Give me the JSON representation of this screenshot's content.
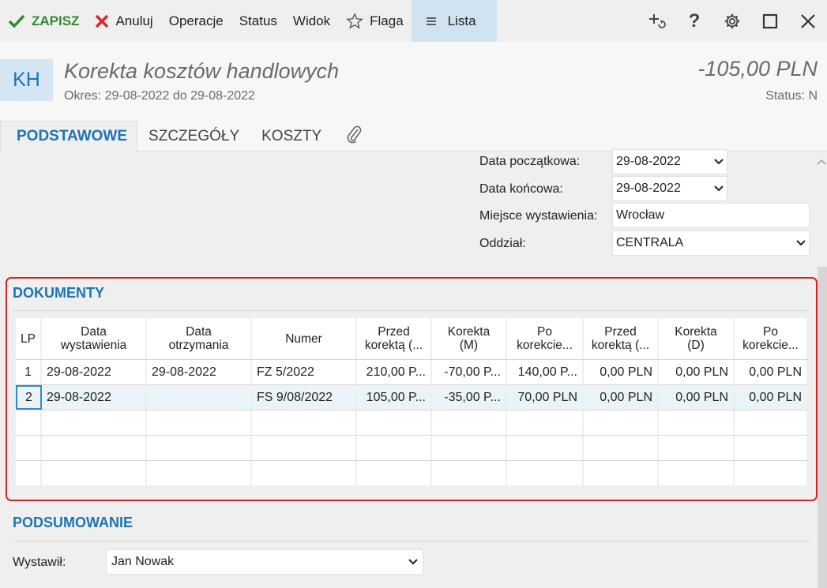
{
  "toolbar": {
    "save": "ZAPISZ",
    "cancel": "Anuluj",
    "operations": "Operacje",
    "status": "Status",
    "view": "Widok",
    "flag": "Flaga",
    "list": "Lista",
    "save_color": "#2e8b2e",
    "cancel_color": "#d9262a",
    "right_icons": [
      "add-refresh-icon",
      "help-icon",
      "gear-icon",
      "maximize-icon",
      "close-icon"
    ]
  },
  "header": {
    "badge": "KH",
    "title": "Korekta kosztów handlowych",
    "period": "Okres: 29-08-2022 do 29-08-2022",
    "amount": "-105,00 PLN",
    "status": "Status: N"
  },
  "tabs": [
    {
      "label": "PODSTAWOWE",
      "active": true
    },
    {
      "label": "SZCZEGÓŁY",
      "active": false
    },
    {
      "label": "KOSZTY",
      "active": false
    }
  ],
  "form": {
    "start_date_label": "Data początkowa:",
    "start_date_value": "29-08-2022",
    "end_date_label": "Data końcowa:",
    "end_date_value": "29-08-2022",
    "place_label": "Miejsce wystawienia:",
    "place_value": "Wrocław",
    "branch_label": "Oddział:",
    "branch_value": "CENTRALA"
  },
  "documents": {
    "title": "DOKUMENTY",
    "columns": [
      [
        "LP"
      ],
      [
        "Data",
        "wystawienia"
      ],
      [
        "Data",
        "otrzymania"
      ],
      [
        "Numer"
      ],
      [
        "Przed",
        "korektą (..."
      ],
      [
        "Korekta",
        "(M)"
      ],
      [
        "Po",
        "korekcie..."
      ],
      [
        "Przed",
        "korektą (..."
      ],
      [
        "Korekta",
        "(D)"
      ],
      [
        "Po",
        "korekcie..."
      ]
    ],
    "rows": [
      [
        "1",
        "29-08-2022",
        "29-08-2022",
        "FZ 5/2022",
        "210,00 P...",
        "-70,00 P...",
        "140,00 P...",
        "0,00 PLN",
        "0,00 PLN",
        "0,00 PLN"
      ],
      [
        "2",
        "29-08-2022",
        "",
        "FS 9/08/2022",
        "105,00 P...",
        "-35,00 P...",
        "70,00 PLN",
        "0,00 PLN",
        "0,00 PLN",
        "0,00 PLN"
      ]
    ],
    "selected_row": 1,
    "highlight_color": "#e02020"
  },
  "summary": {
    "title": "PODSUMOWANIE",
    "issued_by_label": "Wystawił:",
    "issued_by_value": "Jan Nowak"
  }
}
